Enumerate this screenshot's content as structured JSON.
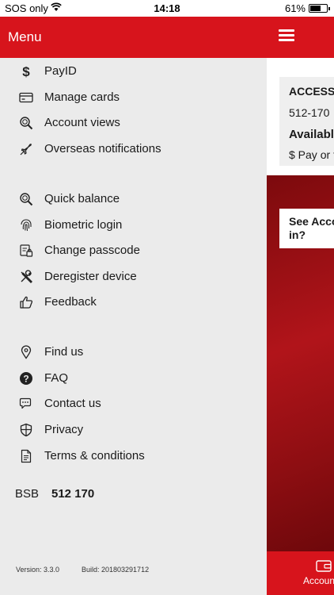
{
  "status_bar": {
    "carrier": "SOS only",
    "time": "14:18",
    "battery": "61%"
  },
  "header": {
    "title": "Menu"
  },
  "menu": {
    "group1": [
      {
        "icon": "dollar-icon",
        "label": "PayID"
      },
      {
        "icon": "card-icon",
        "label": "Manage cards"
      },
      {
        "icon": "magnifier-icon",
        "label": "Account views"
      },
      {
        "icon": "plane-icon",
        "label": "Overseas notifications"
      }
    ],
    "group2": [
      {
        "icon": "magnifier-icon",
        "label": "Quick balance"
      },
      {
        "icon": "fingerprint-icon",
        "label": "Biometric login"
      },
      {
        "icon": "passcode-icon",
        "label": "Change passcode"
      },
      {
        "icon": "tools-icon",
        "label": "Deregister device"
      },
      {
        "icon": "thumbs-up-icon",
        "label": "Feedback"
      }
    ],
    "group3": [
      {
        "icon": "location-pin-icon",
        "label": "Find us"
      },
      {
        "icon": "question-icon",
        "label": "FAQ"
      },
      {
        "icon": "chat-icon",
        "label": "Contact us"
      },
      {
        "icon": "shield-icon",
        "label": "Privacy"
      },
      {
        "icon": "document-icon",
        "label": "Terms & conditions"
      }
    ]
  },
  "bsb": {
    "label": "BSB",
    "value": "512 170"
  },
  "footer": {
    "version": "Version: 3.3.0",
    "build": "Build: 201803291712"
  },
  "account_card": {
    "name": "ACCESS",
    "bsb": "512-170",
    "available": "Availabl",
    "pay": "$ Pay or t"
  },
  "promo": {
    "line1": "See Acco",
    "line2": "in?"
  },
  "bottom_tab": {
    "label": "Accoun"
  },
  "colors": {
    "brand_red": "#d7141c",
    "drawer_bg": "#ebebeb"
  }
}
